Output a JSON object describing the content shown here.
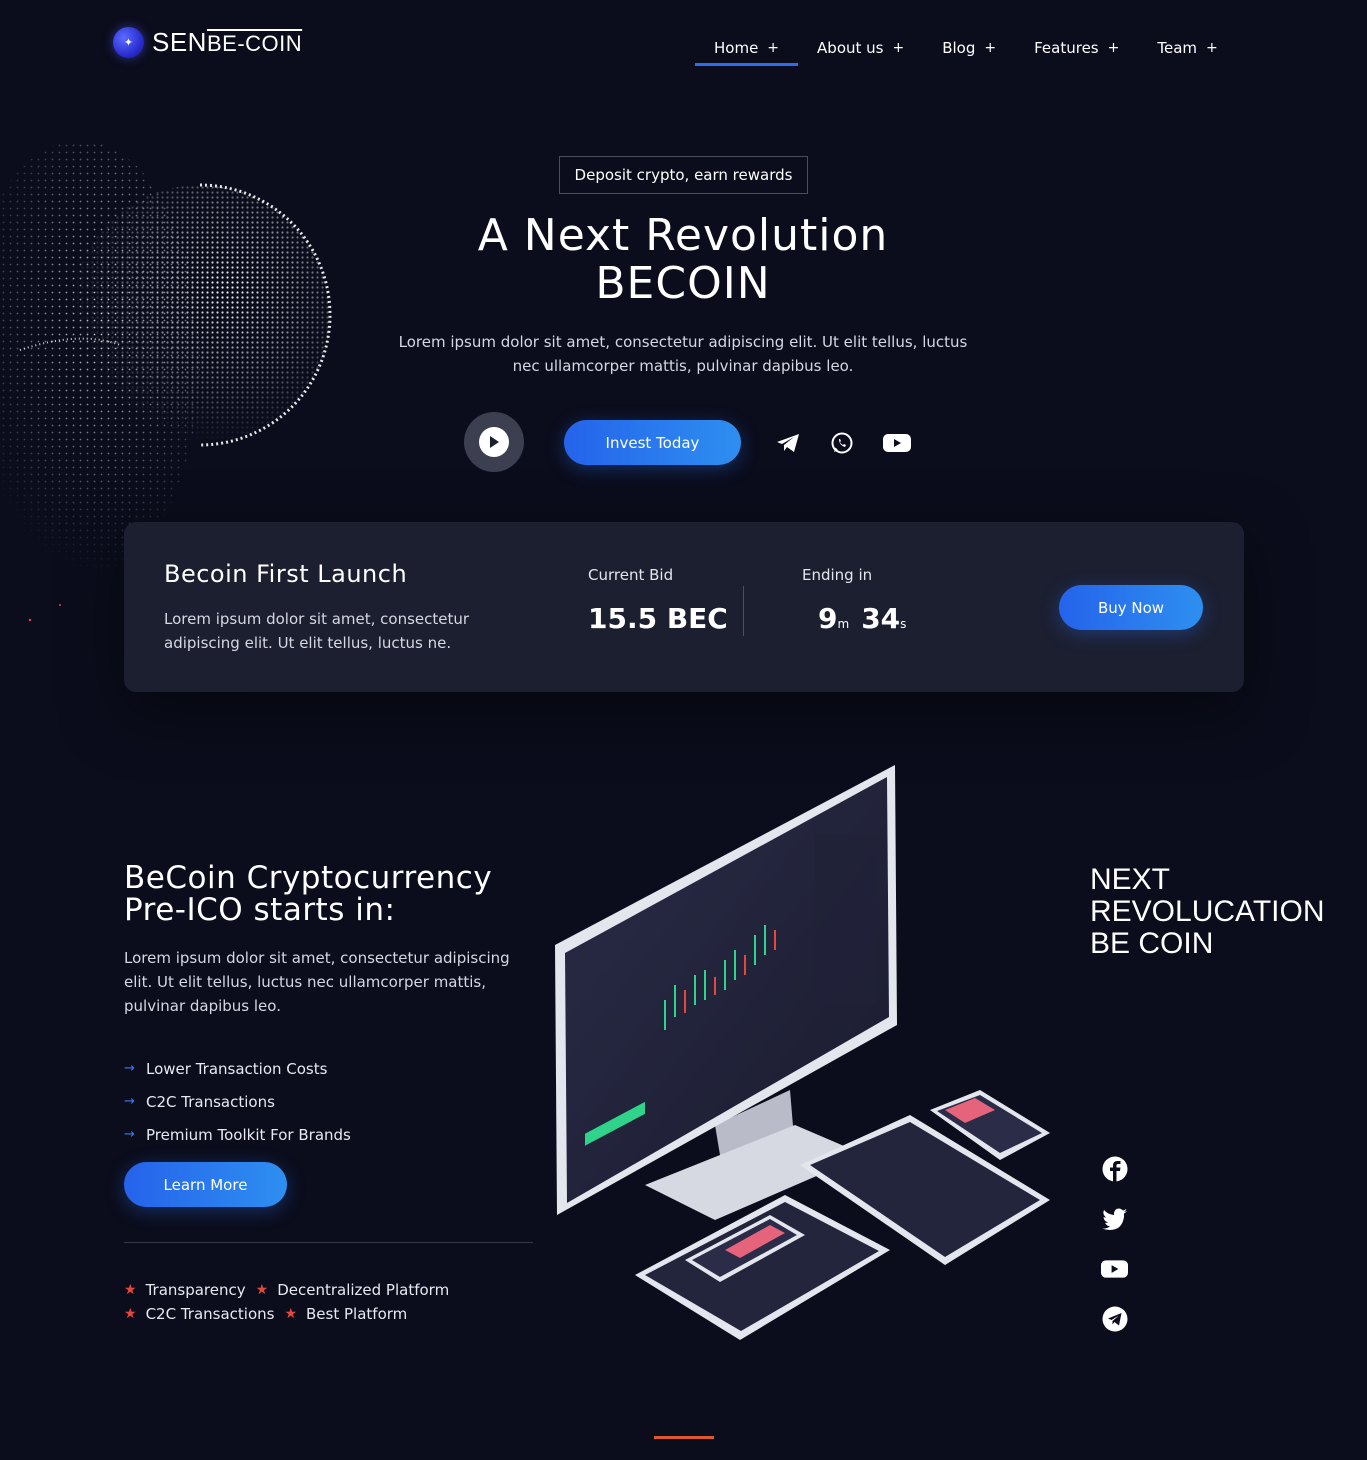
{
  "brand": {
    "name_big": "SEN",
    "name_small": "BE-COIN"
  },
  "nav": [
    {
      "label": "Home",
      "active": true
    },
    {
      "label": "About us",
      "active": false
    },
    {
      "label": "Blog",
      "active": false
    },
    {
      "label": "Features",
      "active": false
    },
    {
      "label": "Team",
      "active": false
    }
  ],
  "hero": {
    "badge": "Deposit crypto, earn rewards",
    "title_line1": "A Next Revolution",
    "title_line2": "BECOIN",
    "description": "Lorem ipsum dolor sit amet, consectetur adipiscing elit. Ut elit tellus, luctus nec ullamcorper mattis, pulvinar dapibus leo.",
    "invest_label": "Invest Today",
    "social_icons": [
      "telegram-icon",
      "whatsapp-icon",
      "youtube-icon"
    ]
  },
  "launch": {
    "title": "Becoin First Launch",
    "description": "Lorem ipsum dolor sit amet, consectetur adipiscing elit. Ut elit tellus, luctus ne.",
    "bid_label": "Current Bid",
    "bid_value": "15.5 BEC",
    "ending_label": "Ending in",
    "minutes": "9",
    "minutes_unit": "m",
    "seconds": "34",
    "seconds_unit": "s",
    "buy_label": "Buy Now"
  },
  "ico": {
    "title_line1": "BeCoin Cryptocurrency",
    "title_line2": "Pre-ICO starts in:",
    "description": "Lorem ipsum dolor sit amet, consectetur adipiscing elit. Ut elit tellus, luctus nec ullamcorper mattis, pulvinar dapibus leo.",
    "features": [
      "Lower Transaction Costs",
      "C2C Transactions",
      "Premium Toolkit For Brands"
    ],
    "learn_label": "Learn More",
    "tags_row1": [
      "Transparency",
      "Decentralized Platform"
    ],
    "tags_row2": [
      "C2C Transactions",
      "Best Platform"
    ]
  },
  "side": {
    "line1": "NEXT",
    "line2": "REVOLUCATION",
    "line3": "BE COIN",
    "social_icons": [
      "facebook-icon",
      "twitter-icon",
      "youtube-icon",
      "telegram-icon"
    ]
  },
  "colors": {
    "background": "#0b0d1c",
    "card": "#1c1f30",
    "accent_blue": "#2563eb",
    "accent_red": "#e5483b",
    "accent_orange": "#e0572f"
  }
}
